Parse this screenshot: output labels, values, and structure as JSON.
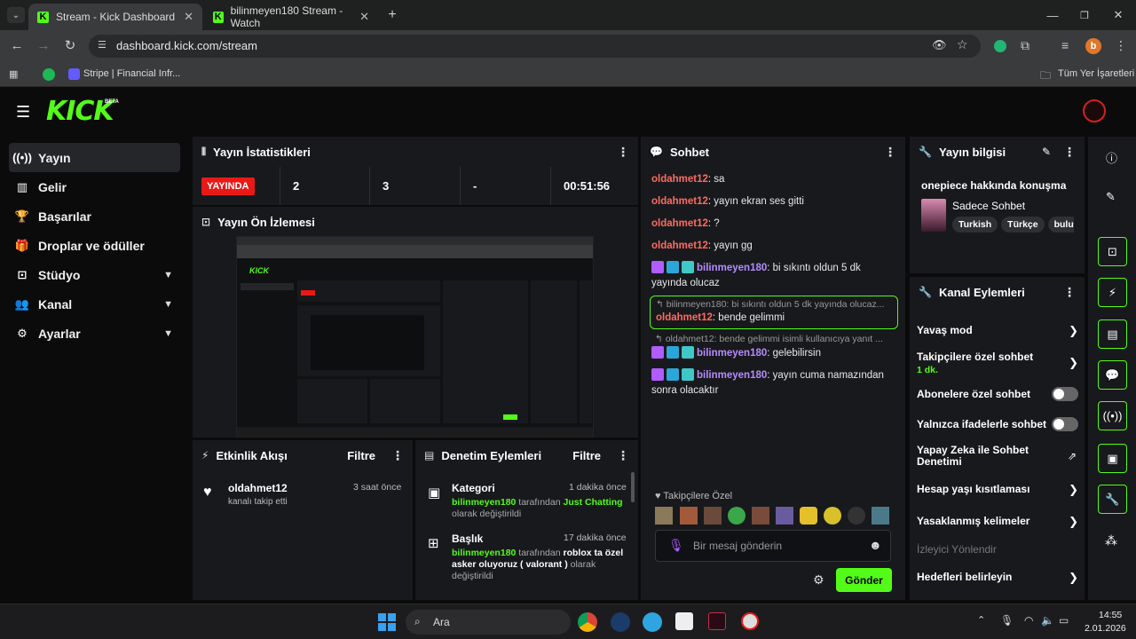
{
  "browser": {
    "tabs": [
      {
        "title": "Stream - Kick Dashboard",
        "active": true
      },
      {
        "title": "bilinmeyen180 Stream - Watch",
        "active": false
      }
    ],
    "url": "dashboard.kick.com/stream",
    "profile_initial": "b",
    "bookmarks": [
      {
        "label": "Stripe | Financial Infr..."
      }
    ],
    "all_bookmarks": "Tüm Yer İşaretleri"
  },
  "app": {
    "logo": "KICK",
    "logo_badge": "BETA"
  },
  "nav": [
    {
      "label": "Yayın",
      "icon": "broadcast-icon"
    },
    {
      "label": "Gelir",
      "icon": "chart-icon"
    },
    {
      "label": "Başarılar",
      "icon": "trophy-icon"
    },
    {
      "label": "Droplar ve ödüller",
      "icon": "gift-icon"
    },
    {
      "label": "Stüdyo",
      "icon": "studio-icon"
    },
    {
      "label": "Kanal",
      "icon": "user-group-icon"
    },
    {
      "label": "Ayarlar",
      "icon": "gear-icon"
    }
  ],
  "stats": {
    "title": "Yayın İstatistikleri",
    "live": "YAYINDA",
    "viewers": "2",
    "followers": "3",
    "subs": "-",
    "duration": "00:51:56"
  },
  "preview": {
    "title": "Yayın Ön İzlemesi"
  },
  "activity": {
    "title": "Etkinlik Akışı",
    "filter": "Filtre",
    "items": [
      {
        "user": "oldahmet12",
        "text": "kanalı takip etti",
        "time": "3 saat önce"
      }
    ]
  },
  "moderation": {
    "title": "Denetim Eylemleri",
    "filter": "Filtre",
    "items": [
      {
        "title": "Kategori",
        "time": "1 dakika önce",
        "user": "bilinmeyen180",
        "mid": " tarafından ",
        "value": "Just Chatting",
        "suffix": "olarak değiştirildi"
      },
      {
        "title": "Başlık",
        "time": "17 dakika önce",
        "user": "bilinmeyen180",
        "mid": " tarafından ",
        "value": "roblox ta özel asker oluyoruz ( valorant )",
        "suffix": " olarak değiştirildi"
      }
    ]
  },
  "chat": {
    "title": "Sohbet",
    "messages": [
      {
        "user": "oldahmet12",
        "text": ": sa"
      },
      {
        "user": "oldahmet12",
        "text": ": yayın ekran ses gitti"
      },
      {
        "user": "oldahmet12",
        "text": ": ?"
      },
      {
        "user": "oldahmet12",
        "text": ": yayın gg"
      },
      {
        "user": "bilinmeyen180",
        "text": ": bi sıkıntı oldun 5 dk yayında olucaz"
      }
    ],
    "reply1": {
      "quote": "bilinmeyen180: bi sıkıntı oldun 5 dk yayında olucaz...",
      "user": "oldahmet12",
      "text": ": bende gelimmi"
    },
    "reply2": {
      "quote": "oldahmet12: bende gelimmi isimli kullanıcıya yanıt ...",
      "user": "bilinmeyen180",
      "text": ": gelebilirsin"
    },
    "last": {
      "user": "bilinmeyen180",
      "text": ": yayın cuma namazından sonra olacaktır"
    },
    "followers_only": "Takipçilere Özel",
    "placeholder": "Bir mesaj gönderin",
    "send": "Gönder"
  },
  "info": {
    "title": "Yayın bilgisi",
    "stream_title": "onepiece hakkında konuşma",
    "category": "Sadece Sohbet",
    "tags": [
      "Turkish",
      "Türkçe",
      "bulut"
    ]
  },
  "channel_actions": {
    "title": "Kanal Eylemleri",
    "slow": "Yavaş mod",
    "followers_chat": "Takipçilere özel sohbet",
    "followers_chat_sub": "1 dk.",
    "subs_chat": "Abonelere özel sohbet",
    "emote_chat": "Yalnızca ifadelerle sohbet",
    "ai_mod": "Yapay Zeka ile Sohbet Denetimi",
    "age": "Hesap yaşı kısıtlaması",
    "banned_words": "Yasaklanmış kelimeler",
    "viewer_redirect": "İzleyici Yönlendir",
    "goals": "Hedefleri belirleyin"
  },
  "taskbar": {
    "search": "Ara",
    "time": "14:55",
    "date": "2.01.2026"
  },
  "colors": {
    "accent": "#53fc18",
    "live": "#e91916",
    "panel": "#18191c"
  }
}
